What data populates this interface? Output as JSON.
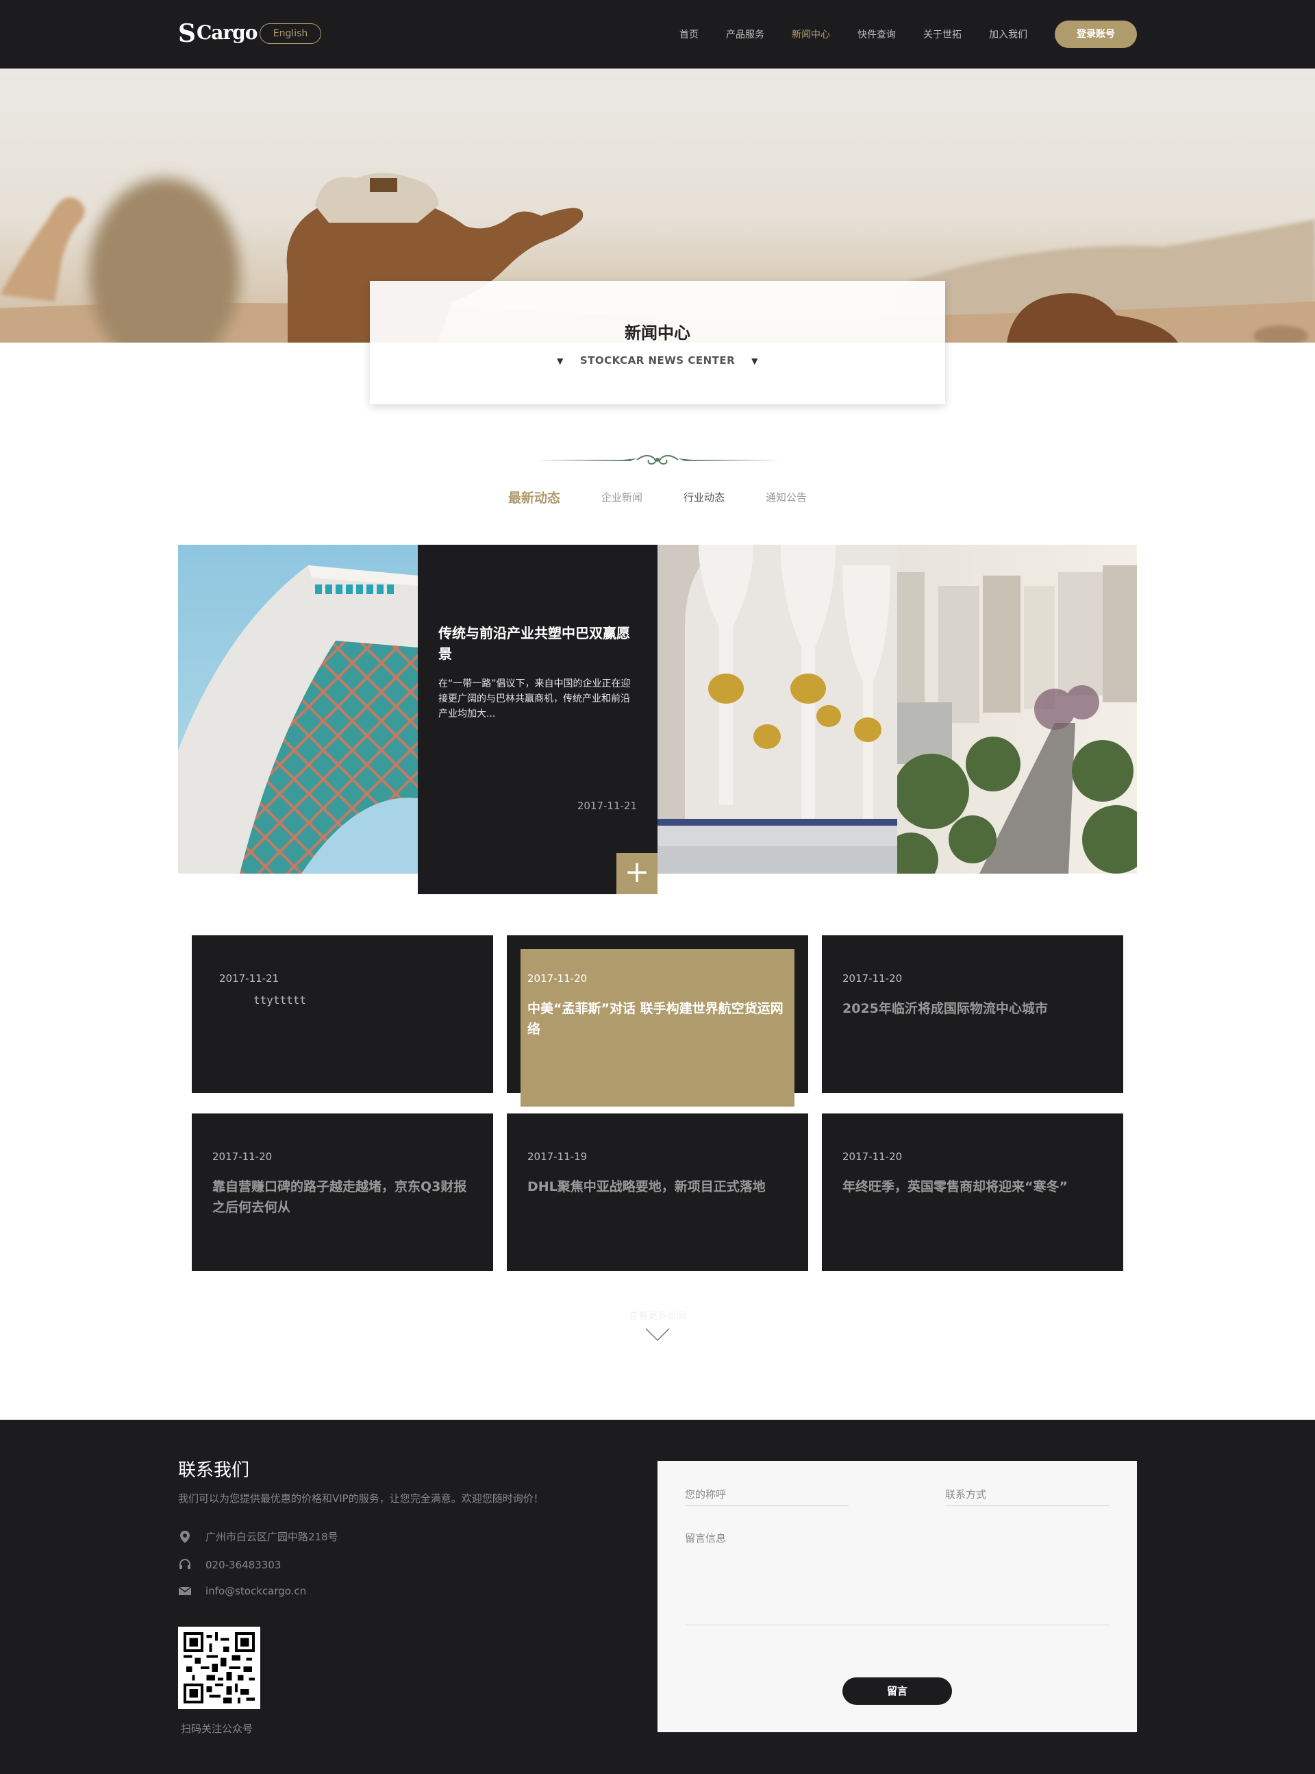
{
  "header": {
    "logo_text": "Cargo",
    "logo_mark": "S",
    "lang_label": "English",
    "nav": [
      {
        "label": "首页",
        "active": false
      },
      {
        "label": "产品服务",
        "active": false
      },
      {
        "label": "新闻中心",
        "active": true
      },
      {
        "label": "快件查询",
        "active": false
      },
      {
        "label": "关于世拓",
        "active": false
      },
      {
        "label": "加入我们",
        "active": false
      }
    ],
    "login_label": "登录账号"
  },
  "hero": {
    "title": "新闻中心",
    "subtitle": "STOCKCAR NEWS CENTER"
  },
  "tabs": [
    {
      "label": "最新动态",
      "active": true
    },
    {
      "label": "企业新闻",
      "active": false
    },
    {
      "label": "行业动态",
      "active": false
    },
    {
      "label": "通知公告",
      "active": false
    }
  ],
  "featured": {
    "title": "传统与前沿产业共塑中巴双赢愿景",
    "description": "在“一带一路”倡议下，来自中国的企业正在迎接更广阔的与巴林共赢商机，传统产业和前沿产业均加大...",
    "date": "2017-11-21",
    "more_icon": "plus-icon"
  },
  "news": [
    {
      "date": "2017-11-21",
      "title": "ttyttttt"
    },
    {
      "date": "2017-11-20",
      "title": "中美“孟菲斯”对话 联手构建世界航空货运网络"
    },
    {
      "date": "2017-11-20",
      "title": "2025年临沂将成国际物流中心城市"
    },
    {
      "date": "2017-11-20",
      "title": "靠自营赚口碑的路子越走越堵，京东Q3财报之后何去何从"
    },
    {
      "date": "2017-11-19",
      "title": "DHL聚焦中亚战略要地，新项目正式落地"
    },
    {
      "date": "2017-11-20",
      "title": "年终旺季，英国零售商却将迎来“寒冬”"
    }
  ],
  "load_more": "查看更多新闻",
  "footer": {
    "title": "联系我们",
    "subtitle": "我们可以为您提供最优惠的价格和VIP的服务，让您完全满意。欢迎您随时询价！",
    "address": "广州市白云区广园中路218号",
    "phone": "020-36483303",
    "email": "info@stockcargo.cn",
    "qr_label": "扫码关注公众号",
    "form": {
      "name_placeholder": "您的称呼",
      "contact_placeholder": "联系方式",
      "message_placeholder": "留言信息",
      "submit_label": "留言"
    }
  },
  "colors": {
    "accent": "#b09b6c",
    "dark": "#1c1c1e"
  }
}
